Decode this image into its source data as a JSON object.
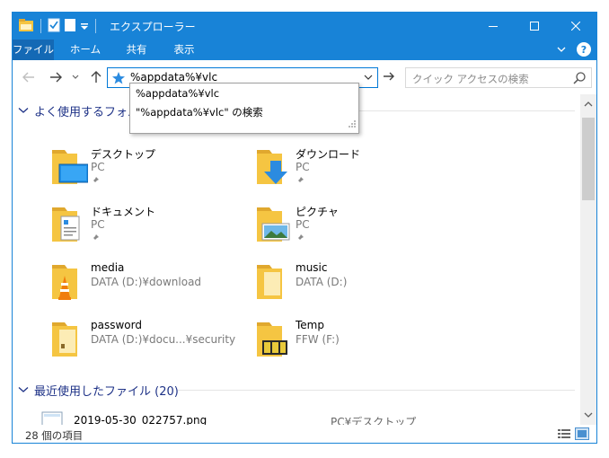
{
  "window": {
    "title": "エクスプローラー"
  },
  "ribbon": {
    "tabs": [
      "ファイル",
      "ホーム",
      "共有",
      "表示"
    ],
    "help_label": "?"
  },
  "navbar": {
    "address_value": "%appdata%¥vlc",
    "search_placeholder": "クイック アクセスの検索"
  },
  "dropdown": {
    "items": [
      "%appdata%¥vlc",
      "\"%appdata%¥vlc\" の検索"
    ]
  },
  "groups": {
    "frequent": {
      "label": "よく使用するフォルダー"
    },
    "recent": {
      "label": "最近使用したファイル (20)"
    }
  },
  "folders": [
    {
      "name": "デスクトップ",
      "location": "PC",
      "pinned": true,
      "icon": "desktop-folder-icon"
    },
    {
      "name": "ダウンロード",
      "location": "PC",
      "pinned": true,
      "icon": "downloads-folder-icon"
    },
    {
      "name": "ドキュメント",
      "location": "PC",
      "pinned": true,
      "icon": "documents-folder-icon"
    },
    {
      "name": "ピクチャ",
      "location": "PC",
      "pinned": true,
      "icon": "pictures-folder-icon"
    },
    {
      "name": "media",
      "location": "DATA (D:)¥download",
      "pinned": false,
      "icon": "vlc-folder-icon"
    },
    {
      "name": "music",
      "location": "DATA (D:)",
      "pinned": false,
      "icon": "folder-icon"
    },
    {
      "name": "password",
      "location": "DATA (D:)¥docu...¥security",
      "pinned": false,
      "icon": "folder-icon"
    },
    {
      "name": "Temp",
      "location": "FFW (F:)",
      "pinned": false,
      "icon": "temp-folder-icon"
    }
  ],
  "recent_files": [
    {
      "name": "2019-05-30_022757.png",
      "location": "PC¥デスクトップ"
    }
  ],
  "status": {
    "item_count": "28 個の項目"
  },
  "colors": {
    "accent": "#1883d7",
    "group_header": "#1e3287",
    "folder": "#f5c542"
  }
}
